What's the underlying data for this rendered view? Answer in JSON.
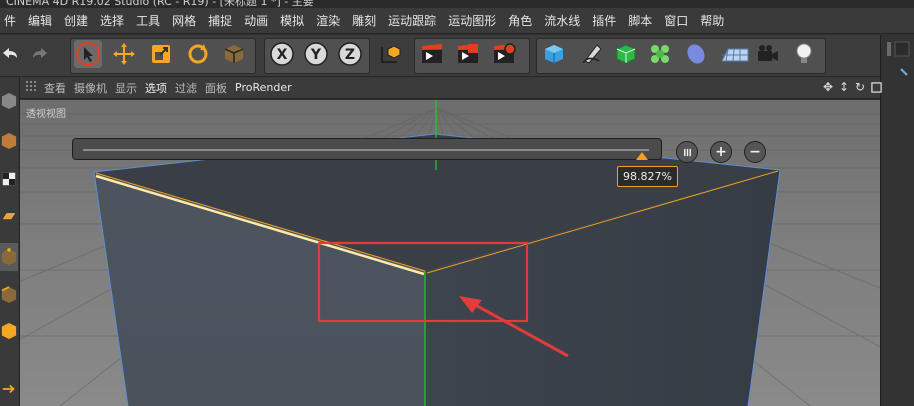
{
  "window": {
    "title": "CINEMA 4D R19.02 Studio (RC - R19) - [未标题 1 *] - 主要"
  },
  "menubar": {
    "items": [
      "件",
      "编辑",
      "创建",
      "选择",
      "工具",
      "网格",
      "捕捉",
      "动画",
      "模拟",
      "渲染",
      "雕刻",
      "运动跟踪",
      "运动图形",
      "角色",
      "流水线",
      "插件",
      "脚本",
      "窗口",
      "帮助"
    ]
  },
  "viewport_menu": {
    "items": [
      "查看",
      "摄像机",
      "显示",
      "选项",
      "过滤",
      "面板",
      "ProRender"
    ],
    "active": "选项"
  },
  "viewport": {
    "label": "透视视图"
  },
  "bevel_slider": {
    "value_label": "98.827%",
    "value": 0.98827
  },
  "colors": {
    "accent": "#f0a020",
    "annotation": "#e23b3b",
    "axis_y": "#22cc22",
    "face_top": "#3a3f46",
    "face_side": "#4b535e"
  },
  "icons": {
    "toolbar": [
      "undo-icon",
      "redo-icon",
      "select-cursor-icon",
      "move-icon",
      "scale-icon",
      "rotate-icon",
      "model-mode-icon",
      "x-axis-lock-icon",
      "y-axis-lock-icon",
      "z-axis-lock-icon",
      "world-coordinates-icon",
      "render-view-icon",
      "render-picture-viewer-icon",
      "render-settings-icon",
      "cube-icon",
      "pen-spline-icon",
      "subdivision-icon",
      "cloner-icon",
      "deformer-icon",
      "floor-icon",
      "camera-icon",
      "light-icon"
    ],
    "viewport_nav": [
      "pan-icon",
      "dolly-icon",
      "orbit-icon",
      "maximize-icon"
    ]
  }
}
